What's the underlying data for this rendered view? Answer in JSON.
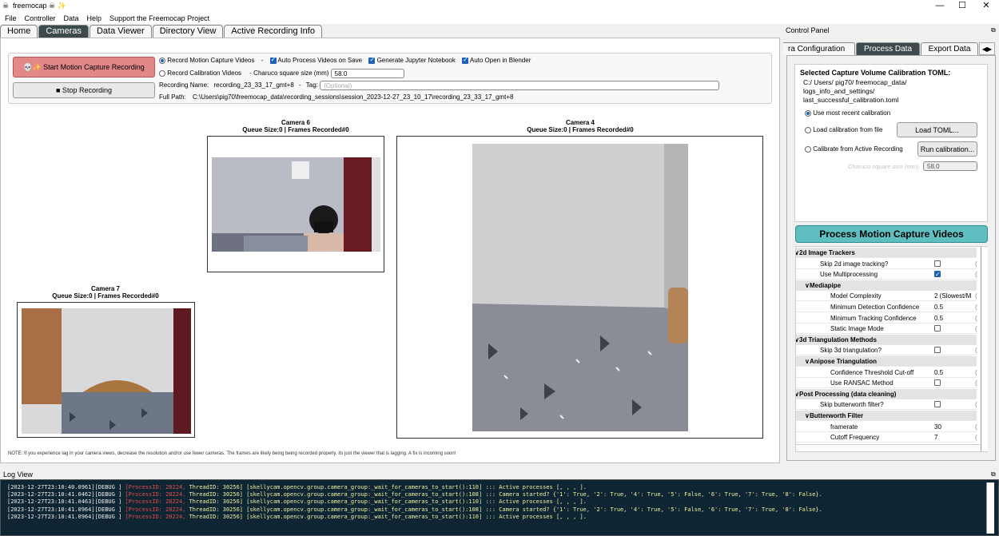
{
  "app": {
    "title": "freemocap",
    "close": "✕",
    "maximize": "☐",
    "minimize": "—"
  },
  "menu": [
    "File",
    "Controller",
    "Data",
    "Help",
    "Support the Freemocap Project"
  ],
  "tabs": [
    "Home",
    "Cameras",
    "Data Viewer",
    "Directory View",
    "Active Recording Info"
  ],
  "controls": {
    "start_label": "💀✨ Start Motion Capture Recording",
    "stop_label": "■ Stop Recording",
    "record_mocap": "Record Motion Capture Videos",
    "dash": "-",
    "auto_process": "Auto Process Videos on Save",
    "gen_jupyter": "Generate Jupyter Notebook",
    "auto_open": "Auto Open in Blender",
    "square_size_value": "58.0",
    "record_calib": "Record Calibration Videos",
    "charuco_label": "Charuco square size (mm)",
    "recording_name_label": "Recording Name:",
    "recording_name": "recording_23_33_17_gmt+8",
    "tag_label": "Tag:",
    "tag_placeholder": "(Optional)",
    "full_path_label": "Full Path:",
    "full_path": "C:\\Users\\pig70\\freemocap_data\\recording_sessions\\session_2023-12-27_23_10_17\\recording_23_33_17_gmt+8"
  },
  "cameras": [
    {
      "title": "Camera 6",
      "status": "Queue Size:0 | Frames Recorded#0"
    },
    {
      "title": "Camera 4",
      "status": "Queue Size:0 | Frames Recorded#0"
    },
    {
      "title": "Camera 7",
      "status": "Queue Size:0 | Frames Recorded#0"
    }
  ],
  "note": "NOTE: If you experience lag in your camera views, decrease the resolution and/or use fewer cameras. The frames are likely being being recorded properly, its just the viewer that is lagging. A fix is incoming soon!",
  "control_panel": {
    "title": "Control Panel",
    "tabs": [
      "ra Configuration",
      "Process Data",
      "Export Data"
    ],
    "cal_heading": "Selected Capture Volume Calibration TOML:",
    "cal_path": "C:/ Users/ pig70/ freemocap_data/ logs_info_and_settings/ last_successful_calibration.toml",
    "opt_recent": "Use most recent calibration",
    "opt_file": "Load calibration from file",
    "load_btn": "Load TOML...",
    "opt_active": "Calibrate from Active Recording",
    "run_btn": "Run calibration...",
    "charuco_faint": "Charuco square size (mm)",
    "square_value": "58.0",
    "process_btn": "Process Motion Capture Videos"
  },
  "tree": [
    {
      "label": "2d Image Trackers",
      "type": "grp",
      "indent": 0
    },
    {
      "label": "Skip 2d image tracking?",
      "type": "chk",
      "checked": false,
      "indent": 2
    },
    {
      "label": "Use Multiprocessing",
      "type": "chk",
      "checked": true,
      "indent": 2
    },
    {
      "label": "Mediapipe",
      "type": "grp",
      "indent": 1
    },
    {
      "label": "Model Complexity",
      "type": "val",
      "value": "2 (Slowest/M",
      "indent": 3
    },
    {
      "label": "Minimum Detection Confidence",
      "type": "val",
      "value": "0.5",
      "indent": 3
    },
    {
      "label": "Minimum Tracking Confidence",
      "type": "val",
      "value": "0.5",
      "indent": 3
    },
    {
      "label": "Static Image Mode",
      "type": "chk",
      "checked": false,
      "indent": 3
    },
    {
      "label": "3d Triangulation Methods",
      "type": "grp",
      "indent": 0
    },
    {
      "label": "Skip 3d triangulation?",
      "type": "chk",
      "checked": false,
      "indent": 2
    },
    {
      "label": "Anipose Triangulation",
      "type": "grp",
      "indent": 1
    },
    {
      "label": "Confidence Threshold Cut-off",
      "type": "val",
      "value": "0.5",
      "indent": 3
    },
    {
      "label": "Use RANSAC Method",
      "type": "chk",
      "checked": false,
      "indent": 3
    },
    {
      "label": "Post Processing (data cleaning)",
      "type": "grp",
      "indent": 0
    },
    {
      "label": "Skip butterworth filter?",
      "type": "chk",
      "checked": false,
      "indent": 2
    },
    {
      "label": "Butterworth Filter",
      "type": "grp",
      "indent": 1
    },
    {
      "label": "framerate",
      "type": "val",
      "value": "30",
      "indent": 3
    },
    {
      "label": "Cutoff Frequency",
      "type": "val",
      "value": "7",
      "indent": 3
    }
  ],
  "log": {
    "title": "Log View",
    "lines": [
      {
        "ts": "[2023-12-27T23:10:40.0961][DEBUG ]",
        "pid": "[ProcessID: 28224,",
        "rest": " ThreadID: 30256] [skellycam.opencv.group.camera_group:_wait_for_cameras_to_start():110] ::: Active processes [, , , ]."
      },
      {
        "ts": "[2023-12-27T23:10:41.0462][DEBUG ]",
        "pid": "[ProcessID: 28224,",
        "rest": " ThreadID: 30256] [skellycam.opencv.group.camera_group:_wait_for_cameras_to_start():108] ::: Camera started? {'1': True, '2': True, '4': True, '5': False, '6': True, '7': True, '8': False}."
      },
      {
        "ts": "[2023-12-27T23:10:41.0463][DEBUG ]",
        "pid": "[ProcessID: 28224,",
        "rest": " ThreadID: 30256] [skellycam.opencv.group.camera_group:_wait_for_cameras_to_start():110] ::: Active processes [, , , ]."
      },
      {
        "ts": "[2023-12-27T23:10:41.0964][DEBUG ]",
        "pid": "[ProcessID: 28224,",
        "rest": " ThreadID: 30256] [skellycam.opencv.group.camera_group:_wait_for_cameras_to_start():108] ::: Camera started? {'1': True, '2': True, '4': True, '5': False, '6': True, '7': True, '8': False}."
      },
      {
        "ts": "[2023-12-27T23:10:41.0964][DEBUG ]",
        "pid": "[ProcessID: 28224,",
        "rest": " ThreadID: 30256] [skellycam.opencv.group.camera_group:_wait_for_cameras_to_start():110] ::: Active processes [, , , ]."
      }
    ]
  }
}
